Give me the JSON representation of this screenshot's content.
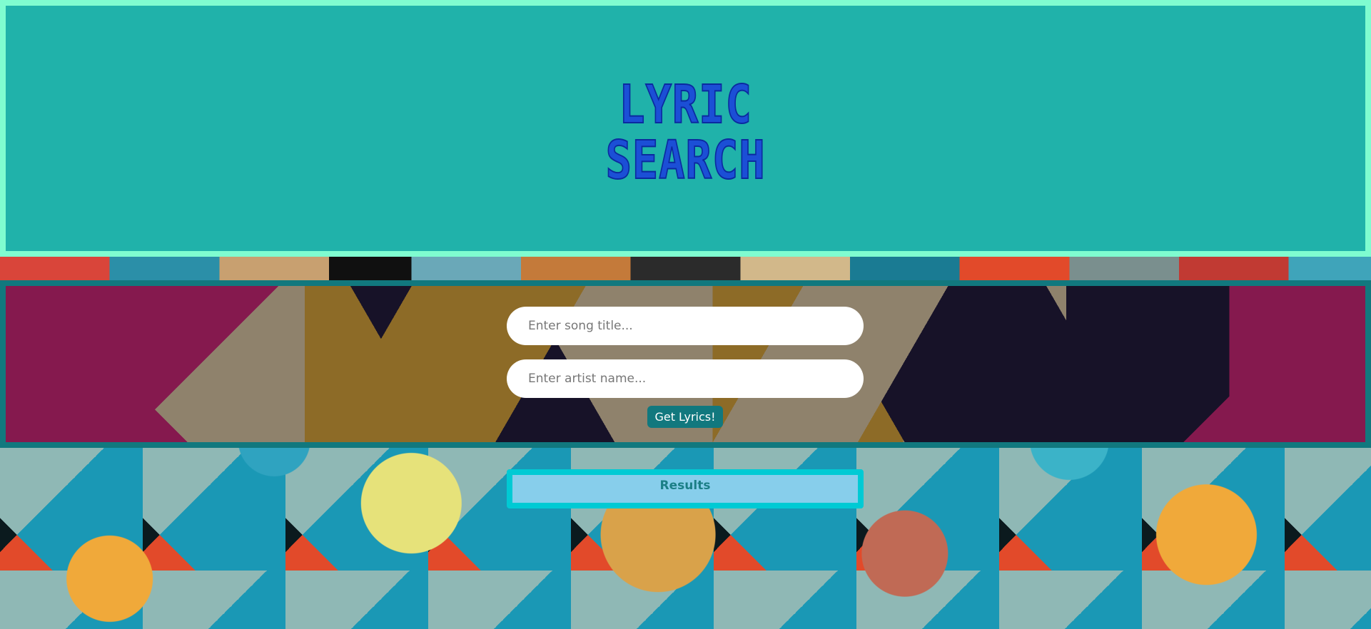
{
  "header": {
    "logo_line1": "LYRIC",
    "logo_line2": "SEARCH"
  },
  "search": {
    "song_placeholder": "Enter song title...",
    "song_value": "",
    "artist_placeholder": "Enter artist name...",
    "artist_value": "",
    "submit_label": "Get Lyrics!"
  },
  "results": {
    "title": "Results"
  },
  "colors": {
    "header_bg": "#20b2aa",
    "header_border": "#7ffcd0",
    "logo": "#1b4fd6",
    "panel_border": "#11787e",
    "button_bg": "#11787e",
    "results_bg": "#87ceeb",
    "results_border": "#00cad4"
  }
}
